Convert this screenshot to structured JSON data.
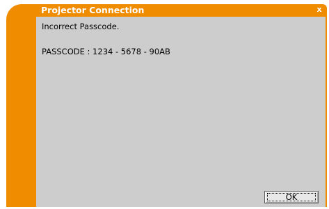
{
  "window": {
    "title": "Projector Connection",
    "close_label": "x"
  },
  "message": {
    "line1": "Incorrect Passcode.",
    "line2": "PASSCODE : 1234 - 5678 - 90AB"
  },
  "buttons": {
    "ok_label": "OK"
  },
  "colors": {
    "accent": "#f08c00",
    "content_bg": "#cdcdcd"
  }
}
